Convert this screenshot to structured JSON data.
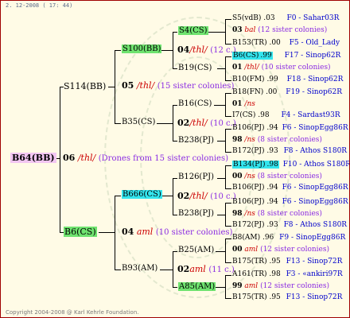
{
  "header": {
    "date_text": "2. 12-2008 ( 17: 44)"
  },
  "footer": {
    "copyright": "Copyright 2004-2008 @ Karl Kehrle Foundation."
  },
  "root": {
    "name": "B64(BB)",
    "gen": "06",
    "mark": "/thl/",
    "note": "(Drones from 15 sister colonies)"
  },
  "left": {
    "top": "S114(BB)",
    "bottom": "B6(CS)"
  },
  "mid": {
    "a": {
      "name": "S100(BB)",
      "gen": "05",
      "mark": "/thl/",
      "note": "(15 sister colonies)"
    },
    "b": {
      "name": "B35(CS)"
    },
    "c": {
      "name": "B666(CS)",
      "gen": "04",
      "mark": "aml",
      "note": "(10 sister colonies)"
    },
    "d": {
      "name": "B93(AM)"
    }
  },
  "q": {
    "a": {
      "name": "S4(CS)",
      "gen": "04",
      "mark": "/thl/",
      "note": "(12 c.)"
    },
    "b": {
      "name": "B19(CS)"
    },
    "c": {
      "name": "B16(CS)",
      "gen": "02",
      "mark": "/thl/",
      "note": "(10 c.)"
    },
    "d": {
      "name": "B238(PJ)"
    },
    "e": {
      "name": "B126(PJ)",
      "gen": "02",
      "mark": "/thl/",
      "note": "(10 c.)"
    },
    "f": {
      "name": "B238(PJ)"
    },
    "g": {
      "name": "B25(AM)",
      "gen": "02",
      "mark": "aml",
      "note": "(11 c.)"
    },
    "h": {
      "name": "A85(AM)"
    }
  },
  "leaves": [
    {
      "name": "S5(vdB)",
      "coef": ".03",
      "id": "F0 - Sahar03R"
    },
    {
      "gen": "03",
      "mark": "bal",
      "note": "(12 sister colonies)"
    },
    {
      "name": "B153(TR)",
      "coef": ".00",
      "id": "F5 - Old_Lady"
    },
    {
      "name": "B6(CS)",
      "coef": ".99",
      "id": "F17 - Sinop62R"
    },
    {
      "gen": "01",
      "mark": "/thl/",
      "note": "(10 sister colonies)"
    },
    {
      "name": "B10(FM)",
      "coef": ".99",
      "id": "F18 - Sinop62R"
    },
    {
      "name": "B18(FN)",
      "coef": ".00",
      "id": "F19 - Sinop62R"
    },
    {
      "gen": "01",
      "mark": "/ns"
    },
    {
      "name": "I7(CS)",
      "coef": ".98",
      "id": "F4 - Sardast93R"
    },
    {
      "name": "B106(PJ)",
      "coef": ".94",
      "id": "F6 - SinopEgg86R"
    },
    {
      "gen": "98",
      "mark": "/ns",
      "note": "(8 sister colonies)"
    },
    {
      "name": "B172(PJ)",
      "coef": ".93",
      "id": "F8 - Athos S180R"
    },
    {
      "name": "B134(PJ)",
      "coef": ".98",
      "id": "F10 - Athos S180R"
    },
    {
      "gen": "00",
      "mark": "/ns",
      "note": "(8 sister colonies)"
    },
    {
      "name": "B106(PJ)",
      "coef": ".94",
      "id": "F6 - SinopEgg86R"
    },
    {
      "name": "B106(PJ)",
      "coef": ".94",
      "id": "F6 - SinopEgg86R"
    },
    {
      "gen": "98",
      "mark": "/ns",
      "note": "(8 sister colonies)"
    },
    {
      "name": "B172(PJ)",
      "coef": ".93",
      "id": "F8 - Athos S180R"
    },
    {
      "name": "B8(AM)",
      "coef": ".96",
      "id": "F9 - SinopEgg86R"
    },
    {
      "gen": "00",
      "mark": "aml",
      "note": "(12 sister colonies)"
    },
    {
      "name": "B175(TR)",
      "coef": ".95",
      "id": "F13 - Sinop72R"
    },
    {
      "name": "A161(TR)",
      "coef": ".98",
      "id": "F3 - «ankiri97R"
    },
    {
      "gen": "99",
      "mark": "aml",
      "note": "(12 sister colonies)"
    },
    {
      "name": "B175(TR)",
      "coef": ".95",
      "id": "F13 - Sinop72R"
    }
  ]
}
